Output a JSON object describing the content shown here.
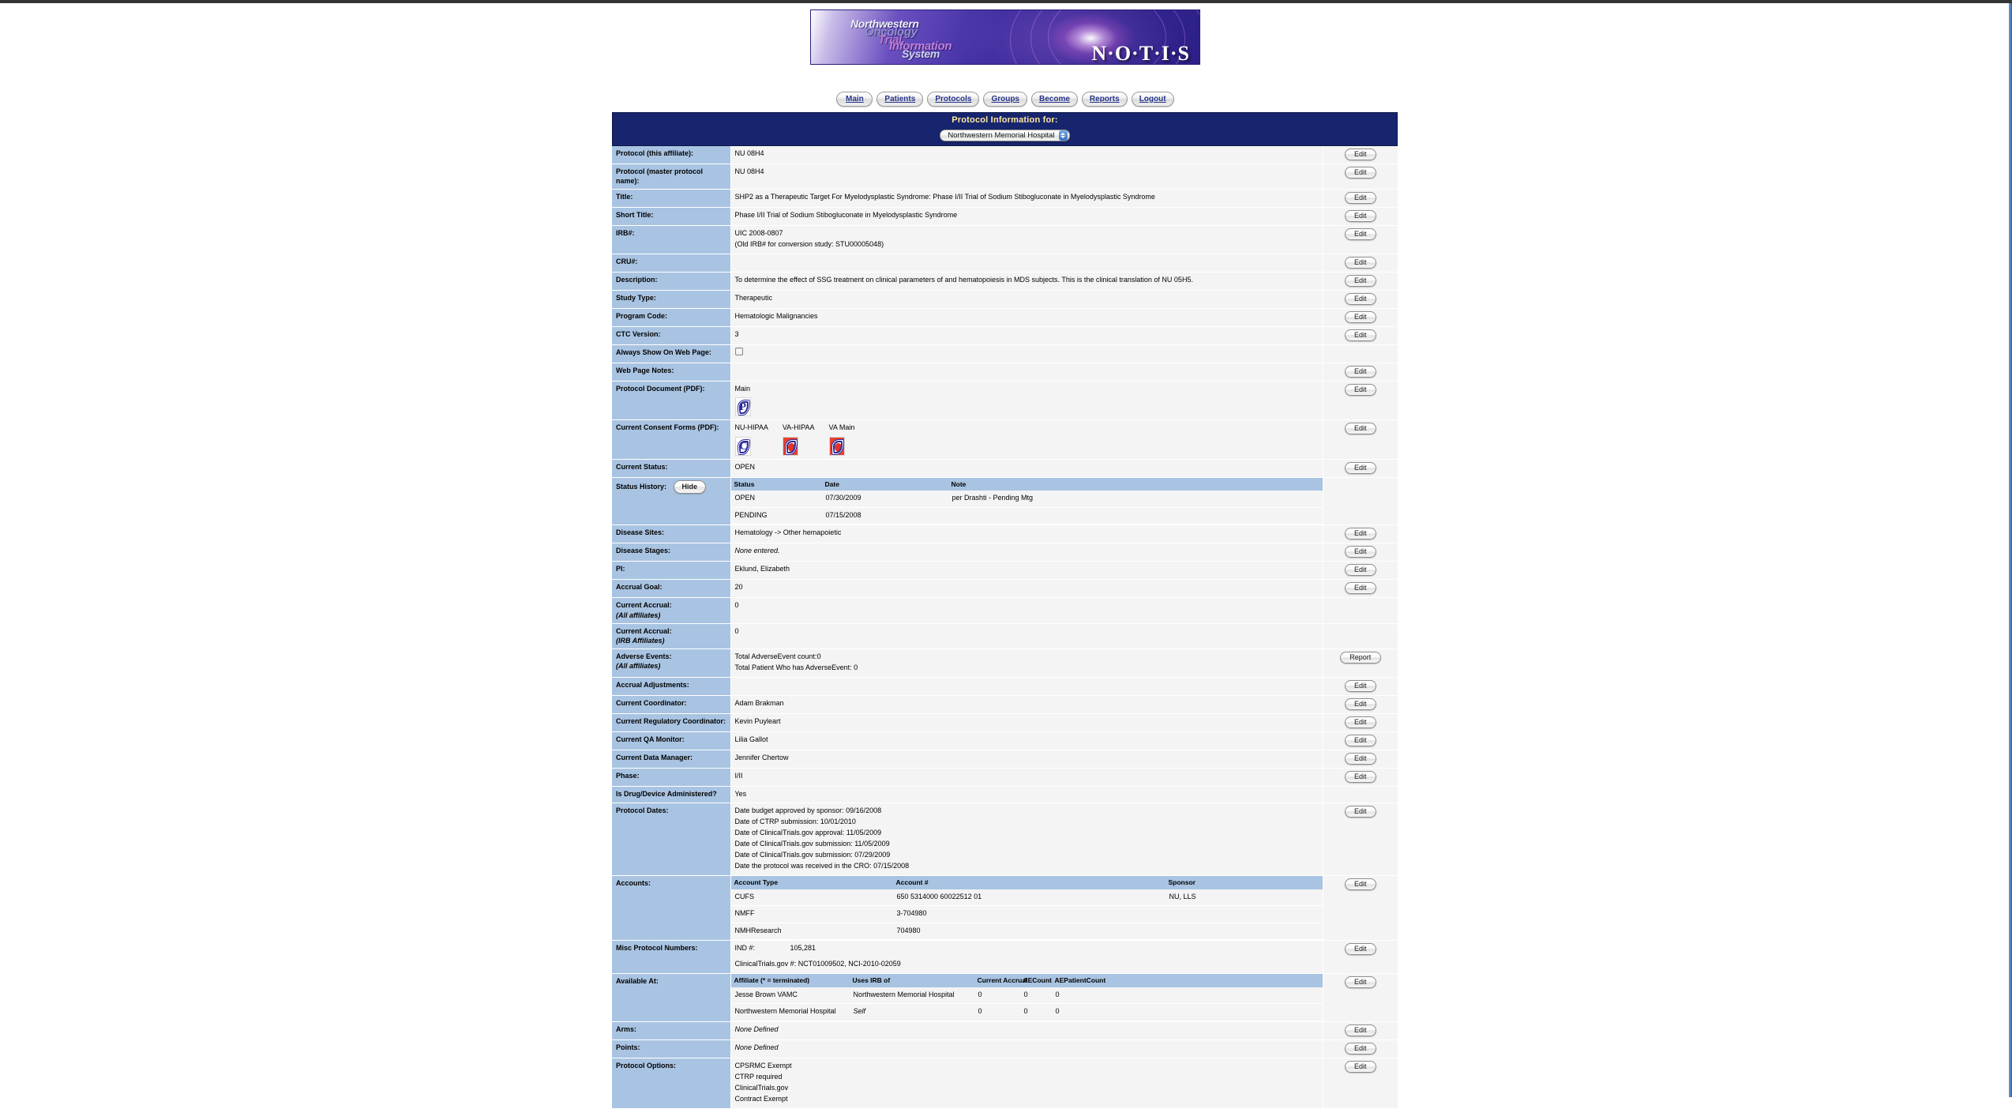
{
  "logo": {
    "words": [
      "Northwestern",
      "Oncology",
      "Trial",
      "Information",
      "System"
    ],
    "acronym": "N·O·T·I·S"
  },
  "nav": {
    "tabs": [
      {
        "label": "Main",
        "name": "nav-tab-main"
      },
      {
        "label": "Patients",
        "name": "nav-tab-patients"
      },
      {
        "label": "Protocols",
        "name": "nav-tab-protocols"
      },
      {
        "label": "Groups",
        "name": "nav-tab-groups"
      },
      {
        "label": "Become",
        "name": "nav-tab-become"
      },
      {
        "label": "Reports",
        "name": "nav-tab-reports"
      },
      {
        "label": "Logout",
        "name": "nav-tab-logout"
      }
    ]
  },
  "header": {
    "title": "Protocol Information for:",
    "affiliate_selected": "Northwestern Memorial Hospital"
  },
  "buttons": {
    "edit": "Edit",
    "report": "Report",
    "hide": "Hide"
  },
  "rows": {
    "protocol_affiliate": {
      "label": "Protocol (this affiliate):",
      "value": "NU 08H4"
    },
    "protocol_master": {
      "label": "Protocol (master protocol name):",
      "value": "NU 08H4"
    },
    "title": {
      "label": "Title:",
      "value": "SHP2 as a Therapeutic Target For Myelodysplastic Syndrome: Phase I/II Trial of Sodium Stibogluconate in Myelodysplastic Syndrome"
    },
    "short_title": {
      "label": "Short Title:",
      "value": "Phase I/II Trial of Sodium Stibogluconate in Myelodysplastic Syndrome"
    },
    "irb": {
      "label": "IRB#:",
      "line1": "UIC 2008-0807",
      "line2": "(Old IRB# for conversion study: STU00005048)"
    },
    "cru": {
      "label": "CRU#:",
      "value": ""
    },
    "description": {
      "label": "Description:",
      "value": "To determine the effect of SSG treatment on clinical parameters of and hematopoiesis in MDS subjects. This is the clinical translation of NU 05H5."
    },
    "study_type": {
      "label": "Study Type:",
      "value": "Therapeutic"
    },
    "program_code": {
      "label": "Program Code:",
      "value": "Hematologic Malignancies"
    },
    "ctc_version": {
      "label": "CTC Version:",
      "value": "3"
    },
    "always_show": {
      "label": "Always Show On Web Page:",
      "checked": false
    },
    "web_page_notes": {
      "label": "Web Page Notes:",
      "value": ""
    },
    "protocol_document": {
      "label": "Protocol Document (PDF):",
      "docs": [
        {
          "caption": "Main",
          "icon": "pdf-icon",
          "style": "plain"
        }
      ]
    },
    "consent_forms": {
      "label": "Current Consent Forms (PDF):",
      "docs": [
        {
          "caption": "NU-HIPAA",
          "icon": "pdf-icon",
          "style": "plain"
        },
        {
          "caption": "VA-HIPAA",
          "icon": "pdf-icon",
          "style": "red"
        },
        {
          "caption": "VA Main",
          "icon": "pdf-icon",
          "style": "red"
        }
      ]
    },
    "current_status": {
      "label": "Current Status:",
      "value": "OPEN"
    },
    "status_history": {
      "label": "Status History:",
      "columns": [
        "Status",
        "Date",
        "Note"
      ],
      "rows": [
        {
          "status": "OPEN",
          "date": "07/30/2009",
          "note": "per Drashti - Pending Mtg"
        },
        {
          "status": "PENDING",
          "date": "07/15/2008",
          "note": ""
        }
      ]
    },
    "disease_sites": {
      "label": "Disease Sites:",
      "value": "Hematology -> Other hemapoietic"
    },
    "disease_stages": {
      "label": "Disease Stages:",
      "value": "None entered."
    },
    "pi": {
      "label": "PI:",
      "value": "Eklund, Elizabeth"
    },
    "accrual_goal": {
      "label": "Accrual Goal:",
      "value": "20"
    },
    "current_accrual_all": {
      "label": "Current Accrual:",
      "sublabel": "(All affiliates)",
      "value": "0"
    },
    "current_accrual_irb": {
      "label": "Current Accrual:",
      "sublabel": "(IRB Affiliates)",
      "value": "0"
    },
    "adverse_events": {
      "label": "Adverse Events:",
      "sublabel": "(All affiliates)",
      "line1": "Total AdverseEvent count:0",
      "line2": "Total Patient Who has AdverseEvent: 0"
    },
    "accrual_adjustments": {
      "label": "Accrual Adjustments:",
      "value": ""
    },
    "current_coordinator": {
      "label": "Current Coordinator:",
      "value": "Adam Brakman"
    },
    "current_regulatory_coordinator": {
      "label": "Current Regulatory Coordinator:",
      "value": "Kevin Puyleart"
    },
    "current_qa_monitor": {
      "label": "Current QA Monitor:",
      "value": "Lilia Gallot"
    },
    "current_data_manager": {
      "label": "Current Data Manager:",
      "value": "Jennifer Chertow"
    },
    "phase": {
      "label": "Phase:",
      "value": "I/II"
    },
    "is_drug_device": {
      "label": "Is Drug/Device Administered?",
      "value": "Yes"
    },
    "protocol_dates": {
      "label": "Protocol Dates:",
      "lines": [
        "Date budget approved by sponsor: 09/16/2008",
        "Date of CTRP submission: 10/01/2010",
        "Date of ClinicalTrials.gov approval: 11/05/2009",
        "Date of ClinicalTrials.gov submission: 11/05/2009",
        "Date of ClinicalTrials.gov submission: 07/29/2009",
        "Date the protocol was received in the CRO: 07/15/2008"
      ]
    },
    "accounts": {
      "label": "Accounts:",
      "columns": [
        "Account Type",
        "Account #",
        "Sponsor"
      ],
      "rows": [
        {
          "type": "CUFS",
          "number": "650 5314000 60022512 01",
          "sponsor": "NU, LLS"
        },
        {
          "type": "NMFF",
          "number": "3-704980",
          "sponsor": ""
        },
        {
          "type": "NMHResearch",
          "number": "704980",
          "sponsor": ""
        }
      ]
    },
    "misc_protocol_numbers": {
      "label": "Misc Protocol Numbers:",
      "ind_key": "IND #:",
      "ind_value": "105,281",
      "ctgov_line": "ClinicalTrials.gov #: NCT01009502, NCI-2010-02059"
    },
    "available_at": {
      "label": "Available At:",
      "columns": [
        "Affiliate (* = terminated)",
        "Uses IRB of",
        "Current Accrual",
        "AECount",
        "AEPatientCount"
      ],
      "rows": [
        {
          "affiliate": "Jesse Brown VAMC",
          "irb": "Northwestern Memorial Hospital",
          "irb_italic": false,
          "accrual": "0",
          "ae": "0",
          "aepatient": "0"
        },
        {
          "affiliate": "Northwestern Memorial Hospital",
          "irb": "Self",
          "irb_italic": true,
          "accrual": "0",
          "ae": "0",
          "aepatient": "0"
        }
      ]
    },
    "arms": {
      "label": "Arms:",
      "value": "None Defined"
    },
    "points": {
      "label": "Points:",
      "value": "None Defined"
    },
    "protocol_options": {
      "label": "Protocol Options:",
      "lines": [
        "CPSRMC Exempt",
        "CTRP required",
        "ClinicalTrials.gov",
        "Contract Exempt"
      ]
    }
  },
  "colors": {
    "label_cell": "#a9c4e2",
    "title_bar": "#17256e",
    "title_text": "#ffe9a0",
    "value_cell": "#f4f4f4",
    "nav_link": "#27348b"
  }
}
